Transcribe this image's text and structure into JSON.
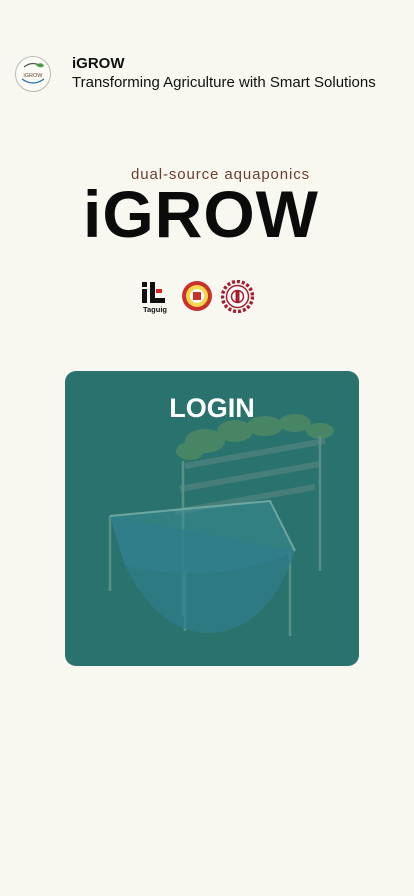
{
  "header": {
    "logo_icon": "igrow-logo-icon",
    "app_name": "iGROW",
    "tagline": "Transforming Agriculture with Smart Solutions"
  },
  "hero": {
    "subtitle": "dual-source aquaponics",
    "title": "iGROW"
  },
  "partners": {
    "taguig_logo_text": "Taguig",
    "logos": [
      "il-taguig-logo",
      "university-seal-icon",
      "gear-seal-icon"
    ]
  },
  "login_card": {
    "label": "LOGIN",
    "background_color": "#2a726d",
    "illustration_icon": "aquaponics-system-illustration"
  },
  "colors": {
    "page_background": "#f8f8f1",
    "subtitle_color": "#6b3f2d",
    "card_color": "#2a726d"
  }
}
